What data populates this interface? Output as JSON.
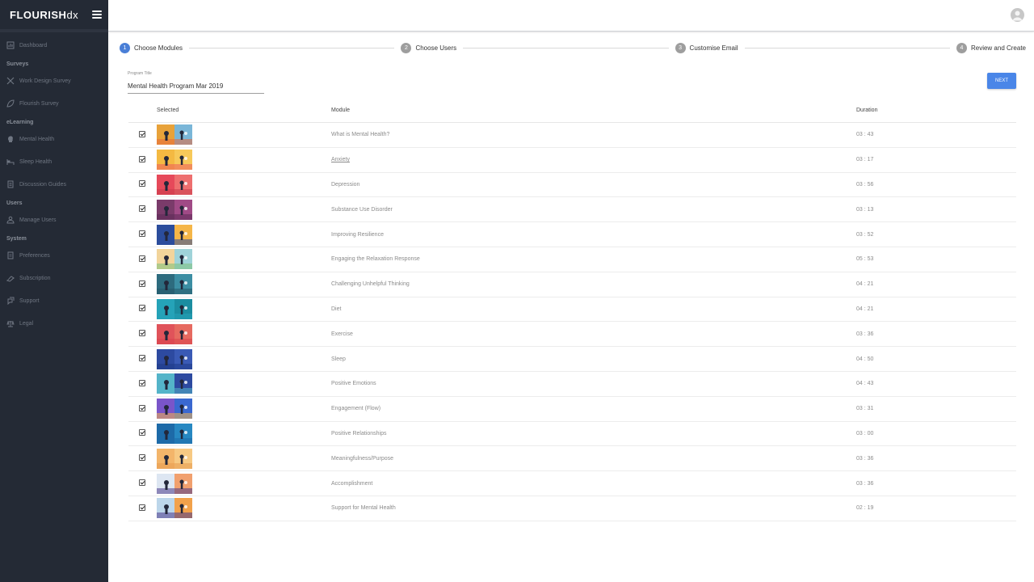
{
  "brand": {
    "name": "FLOURISH",
    "suffix": "dx"
  },
  "sidebar": {
    "sections": [
      {
        "items": [
          {
            "label": "Dashboard",
            "icon": "dashboard-icon"
          }
        ]
      },
      {
        "title": "Surveys",
        "items": [
          {
            "label": "Work Design Survey",
            "icon": "tools-icon"
          },
          {
            "label": "Flourish Survey",
            "icon": "leaf-icon"
          }
        ]
      },
      {
        "title": "eLearning",
        "items": [
          {
            "label": "Mental Health",
            "icon": "head-icon"
          },
          {
            "label": "Sleep Health",
            "icon": "bed-icon"
          },
          {
            "label": "Discussion Guides",
            "icon": "document-icon"
          }
        ]
      },
      {
        "title": "Users",
        "items": [
          {
            "label": "Manage Users",
            "icon": "users-icon"
          }
        ]
      },
      {
        "title": "System",
        "items": [
          {
            "label": "Preferences",
            "icon": "preferences-icon"
          },
          {
            "label": "Subscription",
            "icon": "subscription-icon"
          },
          {
            "label": "Support",
            "icon": "support-icon"
          },
          {
            "label": "Legal",
            "icon": "legal-icon"
          }
        ]
      }
    ]
  },
  "stepper": {
    "steps": [
      {
        "num": "1",
        "label": "Choose Modules",
        "active": true
      },
      {
        "num": "2",
        "label": "Choose Users",
        "active": false
      },
      {
        "num": "3",
        "label": "Customise Email",
        "active": false
      },
      {
        "num": "4",
        "label": "Review and Create",
        "active": false
      }
    ]
  },
  "program": {
    "label": "Program Title",
    "value": "Mental Health Program Mar 2019"
  },
  "next_label": "NEXT",
  "table": {
    "headers": {
      "selected": "Selected",
      "module": "Module",
      "duration": "Duration"
    },
    "rows": [
      {
        "module": "What is Mental Health?",
        "duration": "03 : 43",
        "thumb": [
          "#e8a23a",
          "#7ab6d8",
          "#e56a3c"
        ]
      },
      {
        "module": "Anxiety",
        "duration": "03 : 17",
        "thumb": [
          "#f4b942",
          "#f7c95a",
          "#ef5d5d"
        ],
        "link": true
      },
      {
        "module": "Depression",
        "duration": "03 : 56",
        "thumb": [
          "#e6495a",
          "#ee6f6f",
          "#c93a4a"
        ]
      },
      {
        "module": "Substance Use Disorder",
        "duration": "03 : 13",
        "thumb": [
          "#7a3b6a",
          "#a04a86",
          "#5b2a55"
        ]
      },
      {
        "module": "Improving Resilience",
        "duration": "03 : 52",
        "thumb": [
          "#2b4d9c",
          "#f5b648",
          "#2b4d9c"
        ]
      },
      {
        "module": "Engaging the Relaxation Response",
        "duration": "05 : 53",
        "thumb": [
          "#f2d49b",
          "#9fd3d9",
          "#7cc17c"
        ]
      },
      {
        "module": "Challenging Unhelpful Thinking",
        "duration": "04 : 21",
        "thumb": [
          "#2d6b7e",
          "#3c8ea3",
          "#245768"
        ]
      },
      {
        "module": "Diet",
        "duration": "04 : 21",
        "thumb": [
          "#25a3b8",
          "#1b8da0",
          "#25a3b8"
        ]
      },
      {
        "module": "Exercise",
        "duration": "03 : 36",
        "thumb": [
          "#e0535a",
          "#e66a60",
          "#d9414c"
        ]
      },
      {
        "module": "Sleep",
        "duration": "04 : 50",
        "thumb": [
          "#2d4aa0",
          "#3a5ab5",
          "#1e3a86"
        ]
      },
      {
        "module": "Positive Emotions",
        "duration": "04 : 43",
        "thumb": [
          "#54b4c9",
          "#2d4aa0",
          "#54b4c9"
        ]
      },
      {
        "module": "Engagement (Flow)",
        "duration": "03 : 31",
        "thumb": [
          "#7a55c9",
          "#3a68d0",
          "#f2b24a"
        ]
      },
      {
        "module": "Positive Relationships",
        "duration": "03 : 00",
        "thumb": [
          "#1d6aa8",
          "#2788c2",
          "#1d6aa8"
        ]
      },
      {
        "module": "Meaningfulness/Purpose",
        "duration": "03 : 36",
        "thumb": [
          "#f3b56a",
          "#f7c983",
          "#e89b4e"
        ]
      },
      {
        "module": "Accomplishment",
        "duration": "03 : 36",
        "thumb": [
          "#dde6f2",
          "#f1a06e",
          "#4b3a8a"
        ]
      },
      {
        "module": "Support for Mental Health",
        "duration": "02 : 19",
        "thumb": [
          "#bcd6ea",
          "#f2a14a",
          "#4b3a8a"
        ]
      }
    ]
  },
  "colors": {
    "sidebar_bg": "#242a35",
    "accent": "#4a86e8",
    "step_active": "#4a7fd7",
    "step_inactive": "#9e9e9e"
  }
}
